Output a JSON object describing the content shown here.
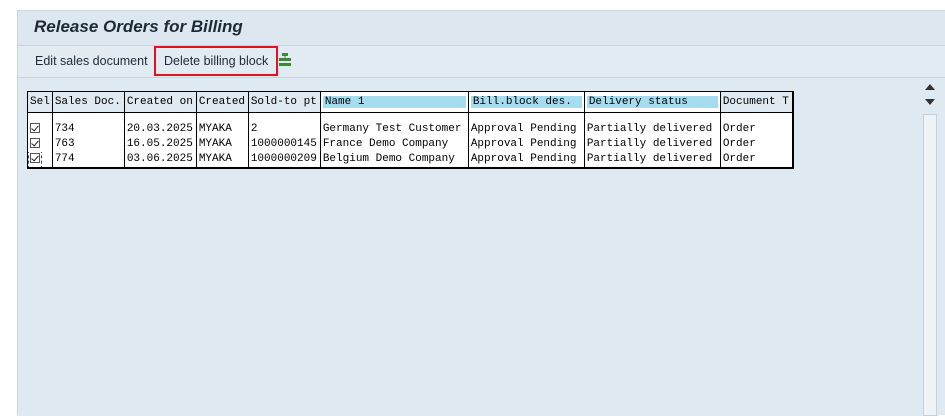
{
  "window": {
    "title": "Release Orders for Billing"
  },
  "toolbar": {
    "edit_label": "Edit sales document",
    "delete_label": "Delete billing block",
    "extra_icon": "hierarchy-icon"
  },
  "table": {
    "columns": [
      "Sel",
      "Sales Doc.",
      "Created on",
      "Created",
      "Sold-to pt",
      "Name 1",
      "Bill.block des.",
      "Delivery status",
      "Document T"
    ],
    "rows": [
      {
        "sel": true,
        "sales_doc": "734",
        "created_on": "20.03.2025",
        "created_by": "MYAKA",
        "sold_to": "2",
        "name": "Germany Test Customer",
        "block": "Approval Pending",
        "delivery": "Partially delivered",
        "doc_type": "Order"
      },
      {
        "sel": true,
        "sales_doc": "763",
        "created_on": "16.05.2025",
        "created_by": "MYAKA",
        "sold_to": "1000000145",
        "name": "France Demo Company",
        "block": "Approval Pending",
        "delivery": "Partially delivered",
        "doc_type": "Order"
      },
      {
        "sel": true,
        "sales_doc": "774",
        "created_on": "03.06.2025",
        "created_by": "MYAKA",
        "sold_to": "1000000209",
        "name": "Belgium Demo Company",
        "block": "Approval Pending",
        "delivery": "Partially delivered",
        "doc_type": "Order"
      }
    ]
  },
  "colors": {
    "highlight_border": "#e0141f",
    "header_highlight": "#a6dcef",
    "background": "#dfe9f1"
  }
}
